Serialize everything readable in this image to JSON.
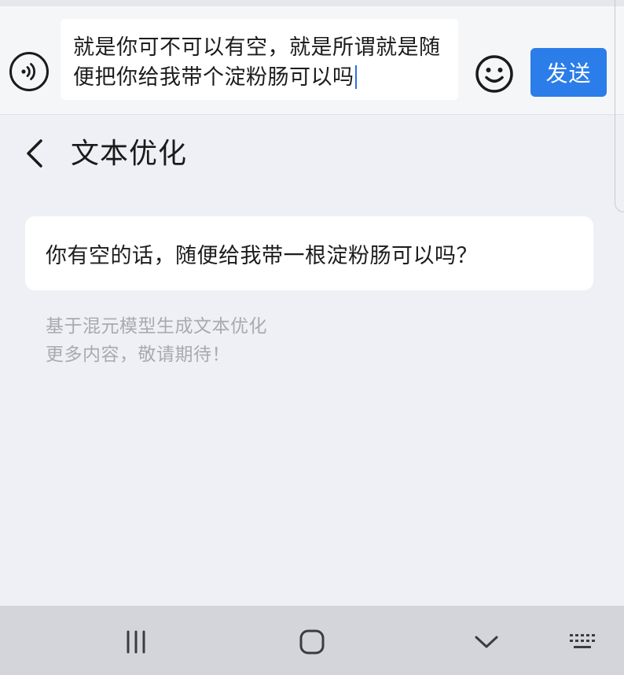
{
  "composer": {
    "input_text": "就是你可不可以有空，就是所谓就是随便把你给我带个淀粉肠可以吗",
    "send_label": "发送",
    "voice_icon": "voice-input-icon",
    "emoji_icon": "emoji-icon"
  },
  "panel": {
    "title": "文本优化",
    "back_icon": "back-chevron-icon"
  },
  "result": {
    "text": "你有空的话，随便给我带一根淀粉肠可以吗？"
  },
  "footnote": {
    "line1": "基于混元模型生成文本优化",
    "line2": "更多内容，敬请期待！"
  },
  "navigation": {
    "items": [
      "recent-apps-icon",
      "home-icon",
      "back-down-icon",
      "keyboard-icon"
    ]
  },
  "colors": {
    "accent": "#2b7de9",
    "background": "#eff0f5",
    "nav_bar": "#d4d5da",
    "hint_text": "#a9aaaf"
  }
}
